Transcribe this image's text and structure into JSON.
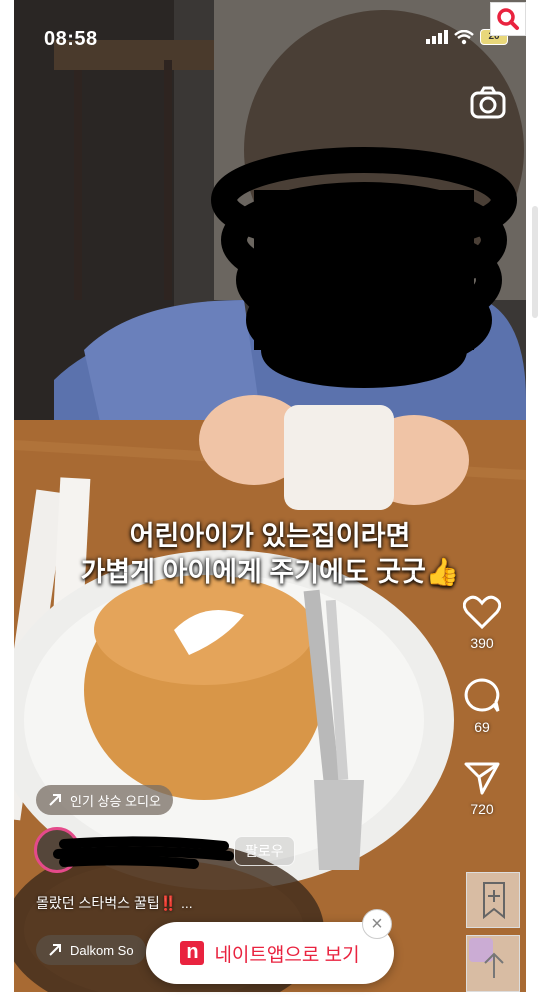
{
  "status_bar": {
    "time": "08:58",
    "battery": "20"
  },
  "caption": {
    "line1": "어린아이가 있는집이라면",
    "line2": "가볍게 아이에게 주기에도 굿굿👍"
  },
  "actions": {
    "likes": "390",
    "comments": "69",
    "shares": "720"
  },
  "audio": {
    "label": "인기 상승 오디오"
  },
  "follow": {
    "label": "팔로우"
  },
  "post": {
    "caption": "몰랐던 스타벅스 꿀팁‼️ ..."
  },
  "track": {
    "label": "Dalkom So"
  },
  "nate": {
    "logo": "n",
    "label": "네이트앱으로 보기"
  },
  "close": {
    "label": "×"
  },
  "icons": {
    "search": "search-icon",
    "camera": "camera-icon",
    "heart": "heart-icon",
    "comment": "comment-icon",
    "send": "send-icon",
    "bookmark": "bookmark-add-icon",
    "arrow_up": "arrow-up-icon"
  },
  "colors": {
    "nate_red": "#e9233f",
    "avatar_ring": "#e44a8a"
  }
}
